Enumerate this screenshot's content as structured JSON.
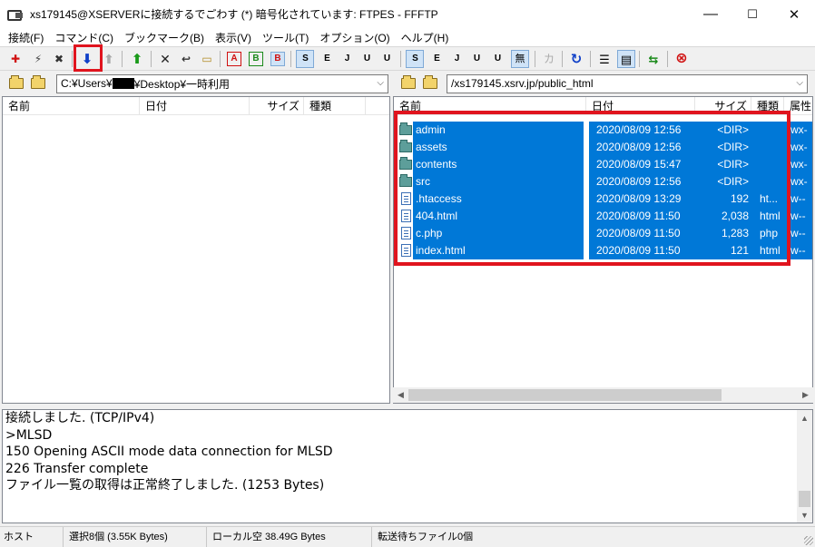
{
  "window": {
    "title": "xs179145@XSERVERに接続するでごわす (*) 暗号化されています: FTPES - FFFTP",
    "minimize": "—",
    "maximize": "☐",
    "close": "✕"
  },
  "menu": [
    "接続(F)",
    "コマンド(C)",
    "ブックマーク(B)",
    "表示(V)",
    "ツール(T)",
    "オプション(O)",
    "ヘルプ(H)"
  ],
  "toolbar": {
    "connect": "✚",
    "quick_connect": "⚡",
    "disconnect": "✖",
    "download": "⬇",
    "upload": "⬆",
    "mirror_upload": "⬆",
    "delete": "✕",
    "rename": "↩",
    "mkdir": "▭",
    "mode_ascii": "A",
    "mode_binary": "B",
    "mode_auto": "B",
    "sjis": "S",
    "euc": "E",
    "jis": "J",
    "utf8": "U",
    "utf8bom": "U",
    "remote_sjis": "S",
    "remote_euc": "E",
    "remote_jis": "J",
    "remote_utf8": "U",
    "remote_utf8bom": "U",
    "no_convert": "無",
    "kana": "カ",
    "refresh": "↻",
    "list_view": "☰",
    "detail_view": "▤",
    "sync": "⇆",
    "stop": "⊗"
  },
  "local": {
    "path": "C:¥Users¥",
    "path_suffix": "¥Desktop¥一時利用",
    "columns": [
      "名前",
      "日付",
      "サイズ",
      "種類"
    ]
  },
  "remote": {
    "path": "/xs179145.xsrv.jp/public_html",
    "columns": [
      "名前",
      "日付",
      "サイズ",
      "種類",
      "属性"
    ],
    "files": [
      {
        "name": "admin",
        "date": "2020/08/09 12:56",
        "size": "<DIR>",
        "type": "",
        "attr": "rwx-",
        "kind": "folder"
      },
      {
        "name": "assets",
        "date": "2020/08/09 12:56",
        "size": "<DIR>",
        "type": "",
        "attr": "rwx-",
        "kind": "folder"
      },
      {
        "name": "contents",
        "date": "2020/08/09 15:47",
        "size": "<DIR>",
        "type": "",
        "attr": "rwx-",
        "kind": "folder"
      },
      {
        "name": "src",
        "date": "2020/08/09 12:56",
        "size": "<DIR>",
        "type": "",
        "attr": "rwx-",
        "kind": "folder"
      },
      {
        "name": ".htaccess",
        "date": "2020/08/09 13:29",
        "size": "192",
        "type": "ht...",
        "attr": "rw--",
        "kind": "file"
      },
      {
        "name": "404.html",
        "date": "2020/08/09 11:50",
        "size": "2,038",
        "type": "html",
        "attr": "rw--",
        "kind": "file"
      },
      {
        "name": "c.php",
        "date": "2020/08/09 11:50",
        "size": "1,283",
        "type": "php",
        "attr": "rw--",
        "kind": "file"
      },
      {
        "name": "index.html",
        "date": "2020/08/09 11:50",
        "size": "121",
        "type": "html",
        "attr": "rw--",
        "kind": "file"
      }
    ]
  },
  "log": [
    "接続しました. (TCP/IPv4)",
    ">MLSD",
    "150 Opening ASCII mode data connection for MLSD",
    "226 Transfer complete",
    "ファイル一覧の取得は正常終了しました. (1253 Bytes)"
  ],
  "status": {
    "host": "ホスト",
    "selection": "選択8個 (3.55K Bytes)",
    "local_free": "ローカル空 38.49G Bytes",
    "queue": "転送待ちファイル0個"
  },
  "colors": {
    "selection": "#0078d7",
    "highlight": "#e0141e"
  }
}
